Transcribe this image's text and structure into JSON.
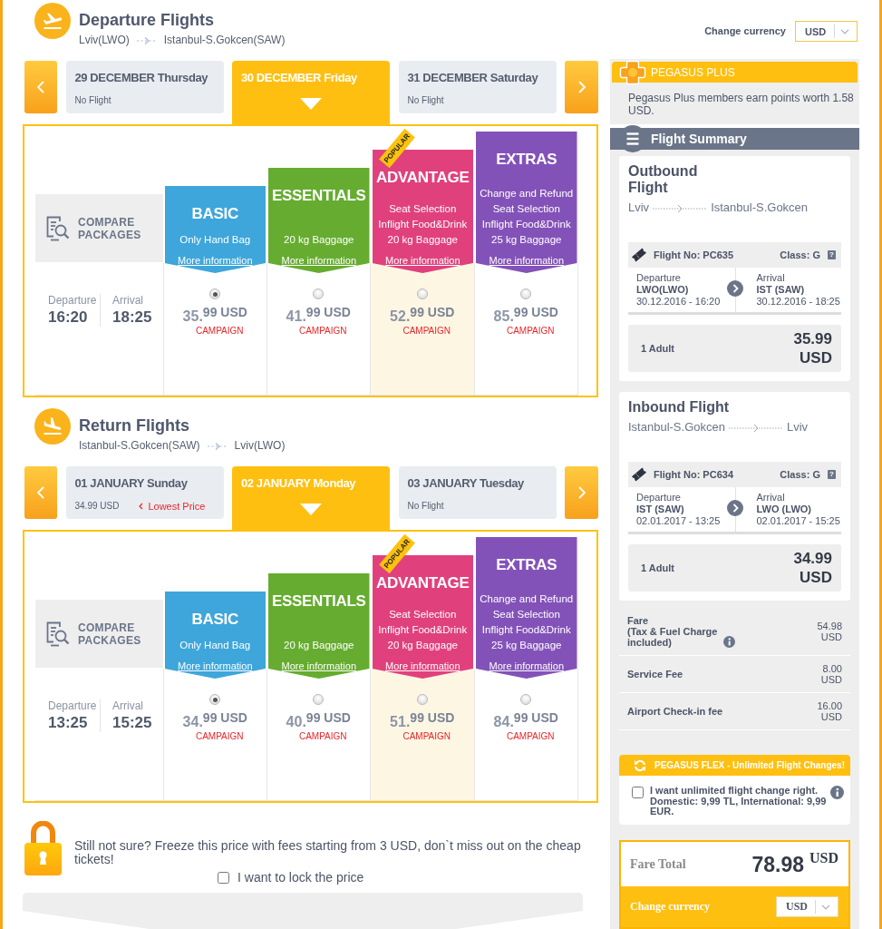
{
  "sections": [
    {
      "kind": "departure",
      "title": "Departure Flights",
      "origin": "Lviv(LWO)",
      "destination": "Istanbul-S.Gokcen(SAW)",
      "dates": [
        {
          "date": "29 DECEMBER Thursday",
          "note": "No Flight",
          "selected": false
        },
        {
          "date": "30 DECEMBER Friday",
          "selected": true
        },
        {
          "date": "31 DECEMBER Saturday",
          "note": "No Flight",
          "selected": false
        }
      ],
      "compare": "COMPARE PACKAGES",
      "times": [
        {
          "label": "Departure",
          "time": "16:20"
        },
        {
          "label": "Arrival",
          "time": "18:25"
        }
      ],
      "packages": [
        {
          "name": "BASIC",
          "color": "#3ea6da",
          "features": [
            "Only Hand Bag"
          ],
          "link": "More information",
          "selected": true,
          "highlighted": false,
          "price": "35.$^{99 USD}$",
          "tag": "CAMPAIGN"
        },
        {
          "name": "ESSENTIALS",
          "color": "#66ac30",
          "features": [
            "20 kg Baggage"
          ],
          "link": "More information",
          "selected": false,
          "highlighted": false,
          "price": "41.$^{99 USD}$",
          "tag": "CAMPAIGN"
        },
        {
          "name": "ADVANTAGE",
          "color": "#e0417c",
          "ribbon": "POPULAR",
          "features": [
            "Seat Selection",
            "Inflight Food&Drink",
            "20 kg Baggage"
          ],
          "link": "More information",
          "selected": false,
          "highlighted": true,
          "price": "52.$^{99 USD}$",
          "tag": "CAMPAIGN"
        },
        {
          "name": "EXTRAS",
          "color": "#8352b9",
          "features": [
            "Change and Refund",
            "Seat Selection",
            "Inflight Food&Drink",
            "25 kg Baggage"
          ],
          "link": "More information",
          "selected": false,
          "highlighted": false,
          "price": "85.$^{99 USD}$",
          "tag": "CAMPAIGN"
        }
      ]
    },
    {
      "kind": "return",
      "title": "Return Flights",
      "origin": "Istanbul-S.Gokcen(SAW)",
      "destination": "Lviv(LWO)",
      "dates": [
        {
          "date": "01 JANUARY Sunday",
          "note": "34.99 USD",
          "badge": "Lowest Price",
          "selected": false
        },
        {
          "date": "02 JANUARY Monday",
          "selected": true
        },
        {
          "date": "03 JANUARY Tuesday",
          "note": "No Flight",
          "selected": false
        }
      ],
      "compare": "COMPARE PACKAGES",
      "times": [
        {
          "label": "Departure",
          "time": "13:25"
        },
        {
          "label": "Arrival",
          "time": "15:25"
        }
      ],
      "packages": [
        {
          "name": "BASIC",
          "color": "#3ea6da",
          "features": [
            "Only Hand Bag"
          ],
          "link": "More information",
          "selected": true,
          "highlighted": false,
          "price": "34.$^{99 USD}$",
          "tag": "CAMPAIGN"
        },
        {
          "name": "ESSENTIALS",
          "color": "#66ac30",
          "features": [
            "20 kg Baggage"
          ],
          "link": "More information",
          "selected": false,
          "highlighted": false,
          "price": "40.$^{99 USD}$",
          "tag": "CAMPAIGN"
        },
        {
          "name": "ADVANTAGE",
          "color": "#e0417c",
          "ribbon": "POPULAR",
          "features": [
            "Seat Selection",
            "Inflight Food&Drink",
            "20 kg Baggage"
          ],
          "link": "More information",
          "selected": false,
          "highlighted": true,
          "price": "51.$^{99 USD}$",
          "tag": "CAMPAIGN"
        },
        {
          "name": "EXTRAS",
          "color": "#8352b9",
          "features": [
            "Change and Refund",
            "Seat Selection",
            "Inflight Food&Drink",
            "25 kg Baggage"
          ],
          "link": "More information",
          "selected": false,
          "highlighted": false,
          "price": "84.$^{99 USD}$",
          "tag": "CAMPAIGN"
        }
      ]
    }
  ],
  "lock": {
    "text": "Still not sure? Freeze this price with fees starting from 3 USD, don`t miss out on the cheap tickets!",
    "option": "I want to lock the price",
    "checked": false
  },
  "sidebar": {
    "currency": {
      "label": "Change currency",
      "value": "USD"
    },
    "plus": {
      "title": "PEGASUS PLUS",
      "text": "Pegasus Plus members earn points worth 1.58 USD."
    },
    "summary_title": "Flight Summary",
    "flights": [
      {
        "title": "Outbound Flight",
        "from": "Lviv",
        "to": "Istanbul-S.Gokcen",
        "flight_no": "Flight No: PC635",
        "class": "Class: G",
        "help": "?",
        "legs": [
          {
            "label": "Departure",
            "airport": "LWO(LWO)",
            "time": "30.12.2016 - 16:20"
          },
          {
            "label": "Arrival",
            "airport": "IST (SAW)",
            "time": "30.12.2016 - 18:25"
          }
        ],
        "passengers": "1 Adult",
        "price": "35.99 USD"
      },
      {
        "title": "Inbound Flight",
        "from": "Istanbul-S.Gokcen",
        "to": "Lviv",
        "flight_no": "Flight No: PC634",
        "class": "Class: G",
        "help": "?",
        "legs": [
          {
            "label": "Departure",
            "airport": "IST (SAW)",
            "time": "02.01.2017 - 13:25"
          },
          {
            "label": "Arrival",
            "airport": "LWO (LWO)",
            "time": "02.01.2017 - 15:25"
          }
        ],
        "passengers": "1 Adult",
        "price": "34.99 USD"
      }
    ],
    "fees": [
      {
        "label": "Fare",
        "note": "(Tax & Fuel Charge included)",
        "amount": "54.98 USD"
      },
      {
        "label": "Service Fee",
        "amount": "8.00 USD"
      },
      {
        "label": "Airport Check-in fee",
        "amount": "16.00 USD"
      }
    ],
    "flex": {
      "title": "PEGASUS FLEX - Unlimited Flight Changes!",
      "text": "I want unlimited flight change right. Domestic: 9,99 TL, International: 9,99 EUR.",
      "checked": false
    },
    "total": {
      "label": "Fare Total",
      "amount": "78.98",
      "currency": "USD",
      "currency_label": "Change currency",
      "currency_value": "USD"
    }
  }
}
